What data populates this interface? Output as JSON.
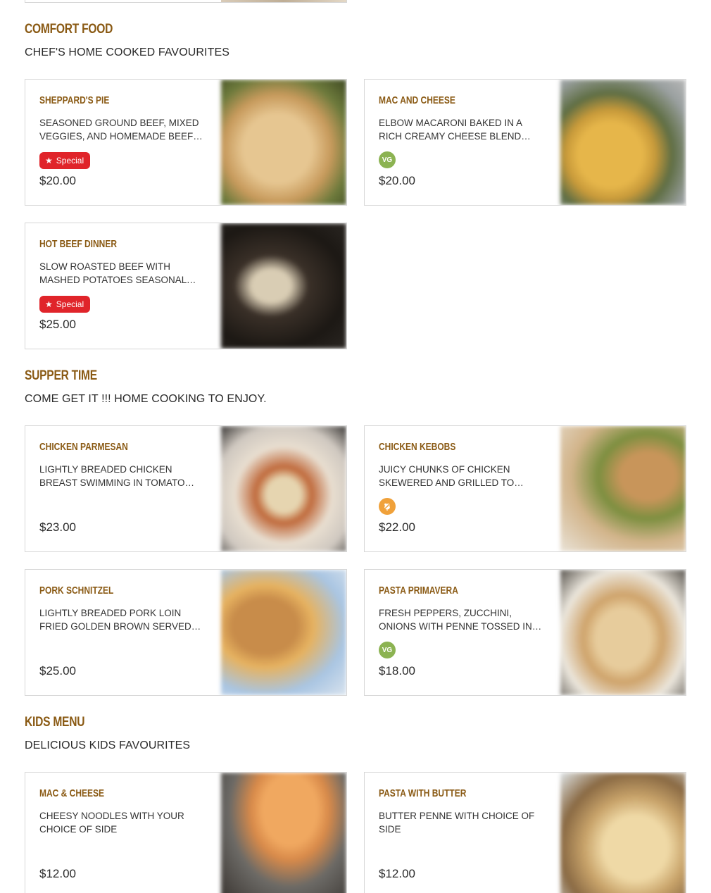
{
  "sections": [
    {
      "title": "COMFORT FOOD",
      "subtitle": "CHEF'S HOME COOKED FAVOURITES",
      "items": [
        {
          "name": "SHEPPARD'S PIE",
          "description": "SEASONED GROUND BEEF, MIXED VEGGIES, AND HOMEMADE BEEF…",
          "badge": "Special",
          "price": "$20.00"
        },
        {
          "name": "MAC AND CHEESE",
          "description": "ELBOW MACARONI BAKED IN A RICH CREAMY CHEESE BLEND TOPPED…",
          "diet": "VG",
          "price": "$20.00"
        },
        {
          "name": "HOT BEEF DINNER",
          "description": "SLOW ROASTED BEEF WITH MASHED POTATOES SEASONAL VEG, SERVED…",
          "badge": "Special",
          "price": "$25.00"
        }
      ]
    },
    {
      "title": "SUPPER TIME",
      "subtitle": "COME GET IT !!! HOME COOKING TO ENJOY.",
      "items": [
        {
          "name": "CHICKEN PARMESAN",
          "description": "LIGHTLY BREADED CHICKEN BREAST SWIMMING IN TOMATO SAUCE…",
          "price": "$23.00"
        },
        {
          "name": "CHICKEN KEBOBS",
          "description": "JUICY CHUNKS OF CHICKEN SKEWERED AND GRILLED TO…",
          "diet_icon": "gluten-free-icon",
          "price": "$22.00"
        },
        {
          "name": "PORK SCHNITZEL",
          "description": "LIGHTLY BREADED PORK LOIN FRIED GOLDEN BROWN SERVED WITH…",
          "price": "$25.00"
        },
        {
          "name": "PASTA PRIMAVERA",
          "description": "FRESH PEPPERS, ZUCCHINI, ONIONS WITH PENNE TOSSED IN YOUR…",
          "diet": "VG",
          "price": "$18.00"
        }
      ]
    },
    {
      "title": "KIDS MENU",
      "subtitle": "DELICIOUS KIDS FAVOURITES",
      "items": [
        {
          "name": "MAC & CHEESE",
          "description": "CHEESY NOODLES WITH YOUR CHOICE OF SIDE",
          "price": "$12.00"
        },
        {
          "name": "PASTA WITH BUTTER",
          "description": "BUTTER PENNE WITH CHOICE OF SIDE",
          "price": "$12.00"
        }
      ]
    }
  ],
  "colors": {
    "title": "#8a5a14",
    "special_badge": "#e0242a",
    "vg_icon": "#8cb352",
    "gf_icon": "#f0a13a"
  }
}
